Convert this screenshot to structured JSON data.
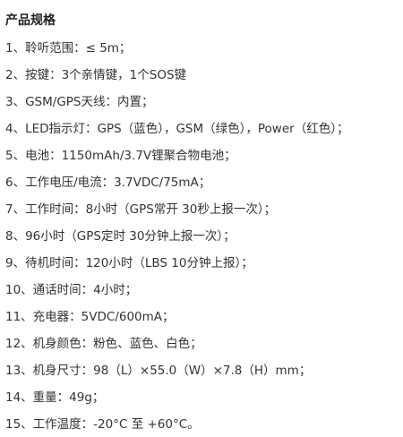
{
  "title": "产品规格",
  "specs": [
    "1、聆听范围：≤ 5m；",
    "2、按键：3个亲情键，1个SOS键",
    "3、GSM/GPS天线：内置；",
    "4、LED指示灯：GPS（蓝色），GSM（绿色），Power（红色）；",
    "5、电池：1150mAh/3.7V锂聚合物电池；",
    "6、工作电压/电流：3.7VDC/75mA；",
    "7、工作时间：8小时（GPS常开 30秒上报一次）；",
    "8、96小时（GPS定时 30分钟上报一次）；",
    "9、待机时间：120小时（LBS 10分钟上报）；",
    "10、通话时间：4小时；",
    "11、充电器：5VDC/600mA；",
    "12、机身颜色：粉色、蓝色、白色；",
    "13、机身尺寸：98（L）×55.0（W）×7.8（H）mm；",
    "14、重量：49g；",
    "15、工作温度：-20°C 至 +60°C。"
  ]
}
